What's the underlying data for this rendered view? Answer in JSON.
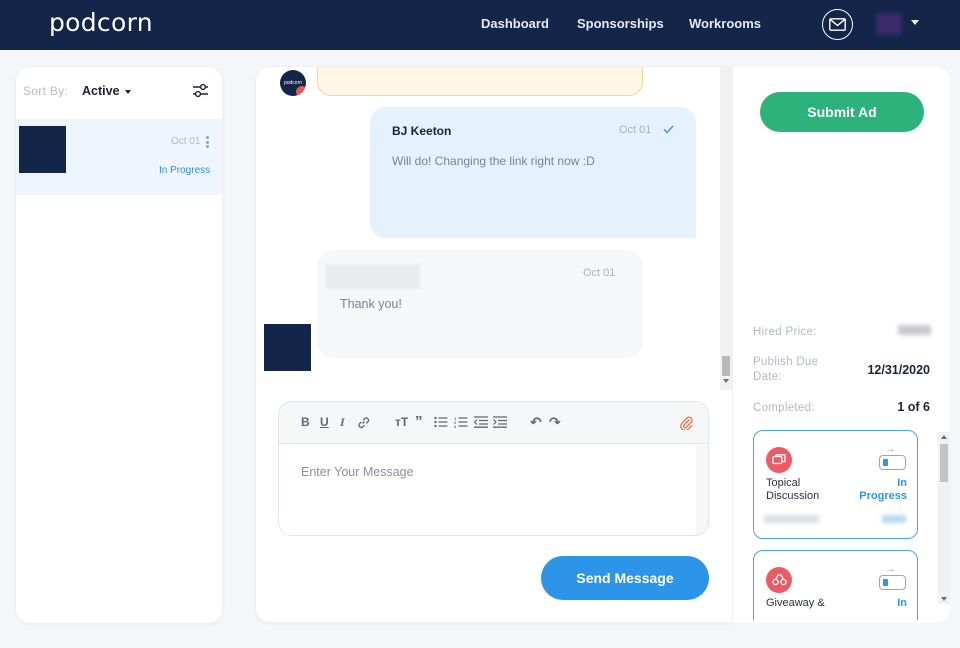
{
  "app": {
    "logo": "podcorn",
    "nav": [
      "Dashboard",
      "Sponsorships",
      "Workrooms"
    ],
    "icons": {
      "mail": "mail-icon",
      "cart": "cart-icon"
    }
  },
  "sidebar": {
    "sort_label": "Sort By:",
    "sort_value": "Active",
    "conversations": [
      {
        "date": "Oct 01",
        "status": "In Progress"
      }
    ]
  },
  "chat": {
    "sender_avatar_text": "podcorn",
    "messages": [
      {
        "author": "BJ Keeton",
        "date": "Oct 01",
        "text": "Will do! Changing the link right now :D",
        "read": true
      },
      {
        "author": "",
        "date": "Oct 01",
        "text": "Thank you!"
      }
    ],
    "editor": {
      "placeholder": "Enter Your Message",
      "toolbar": [
        "bold",
        "underline",
        "italic",
        "link",
        "text-size",
        "quote",
        "bullet-list",
        "numbered-list",
        "outdent",
        "indent",
        "undo",
        "redo",
        "attach"
      ]
    },
    "send_label": "Send Message"
  },
  "details": {
    "submit_label": "Submit Ad",
    "hired_price_label": "Hired Price:",
    "publish_due_label": "Publish Due Date:",
    "publish_due_value": "12/31/2020",
    "completed_label": "Completed:",
    "completed_value": "1 of 6",
    "tasks": [
      {
        "title": "Topical Discussion",
        "status": "In Progress"
      },
      {
        "title": "Giveaway &",
        "status": "In"
      }
    ]
  },
  "colors": {
    "navy": "#14254a",
    "accent_blue": "#2d95e8",
    "green": "#2cb27a",
    "task_icon": "#ea5b66"
  }
}
